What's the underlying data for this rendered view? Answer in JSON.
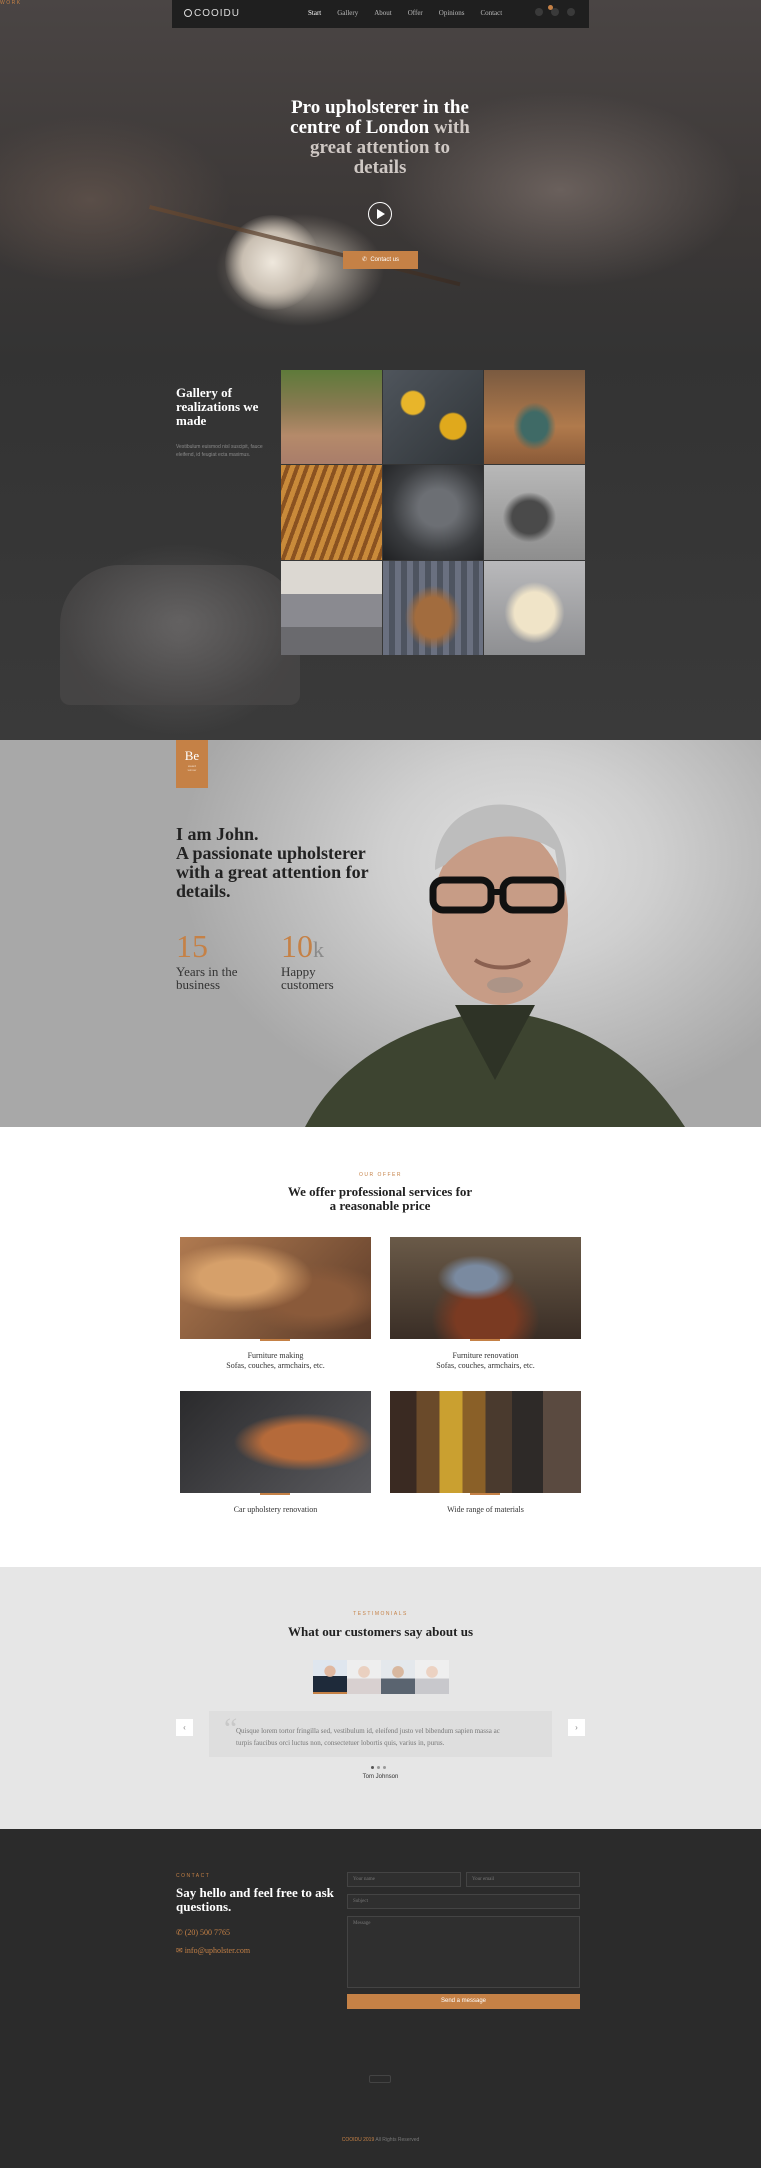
{
  "brand": {
    "logo_text": "COOIDU",
    "accent": "#c58146"
  },
  "nav": {
    "items": [
      "Start",
      "Gallery",
      "About",
      "Offer",
      "Opinions",
      "Contact"
    ],
    "active": "Start",
    "icons": [
      "search-icon",
      "cart-icon",
      "menu-icon"
    ]
  },
  "hero": {
    "title_line1": "Pro upholsterer in the",
    "title_line2a": "centre of London",
    "title_line2b": " with",
    "title_line3": "great attention to",
    "title_line4": "details",
    "button": "Contact us"
  },
  "gallery": {
    "label": "WORK",
    "title": "Gallery of realizations we made",
    "text": "Vestibulum euismod nisl suscipit, fauce eleifend, id feugiat ecta maximus."
  },
  "about": {
    "badge_main": "Be",
    "badge_sub1": "award",
    "badge_sub2": "winner",
    "title_line1": "I am John.",
    "title_line2": "A passionate upholsterer",
    "title_line3": "with a great attention for",
    "title_line4": "details.",
    "stats": [
      {
        "number": "15",
        "suffix": "",
        "label_line1": "Years in the",
        "label_line2": "business"
      },
      {
        "number": "10",
        "suffix": "k",
        "label_line1": "Happy",
        "label_line2": "customers"
      }
    ]
  },
  "offer": {
    "label": "OUR OFFER",
    "title_line1": "We offer professional services for",
    "title_line2": "a reasonable price",
    "cards": [
      {
        "line1": "Furniture making",
        "line2": "Sofas, couches, armchairs, etc."
      },
      {
        "line1": "Furniture renovation",
        "line2": "Sofas, couches, armchairs, etc."
      },
      {
        "line1": "Car upholstery renovation",
        "line2": ""
      },
      {
        "line1": "Wide range of materials",
        "line2": ""
      }
    ]
  },
  "testimonials": {
    "label": "TESTIMONIALS",
    "title": "What our customers say about us",
    "quote_line1": "Quisque lorem tortor fringilla sed, vestibulum id, eleifend justo vel bibendum sapien massa ac",
    "quote_line2": "turpis faucibus orci luctus non, consectetuer lobortis quis, varius in, purus.",
    "author": "Tom Johnson",
    "prev": "‹",
    "next": "›"
  },
  "contact": {
    "label": "CONTACT",
    "title": "Say hello and feel free to ask questions.",
    "phone": "(20) 500 7765",
    "email": "info@upholster.com",
    "placeholders": {
      "name": "Your name",
      "email": "Your email",
      "subject": "Subject",
      "message": "Message"
    },
    "button": "Send a message"
  },
  "footer": {
    "brand": "COOIDU 2019",
    "rights": " All Rights Reserved"
  }
}
